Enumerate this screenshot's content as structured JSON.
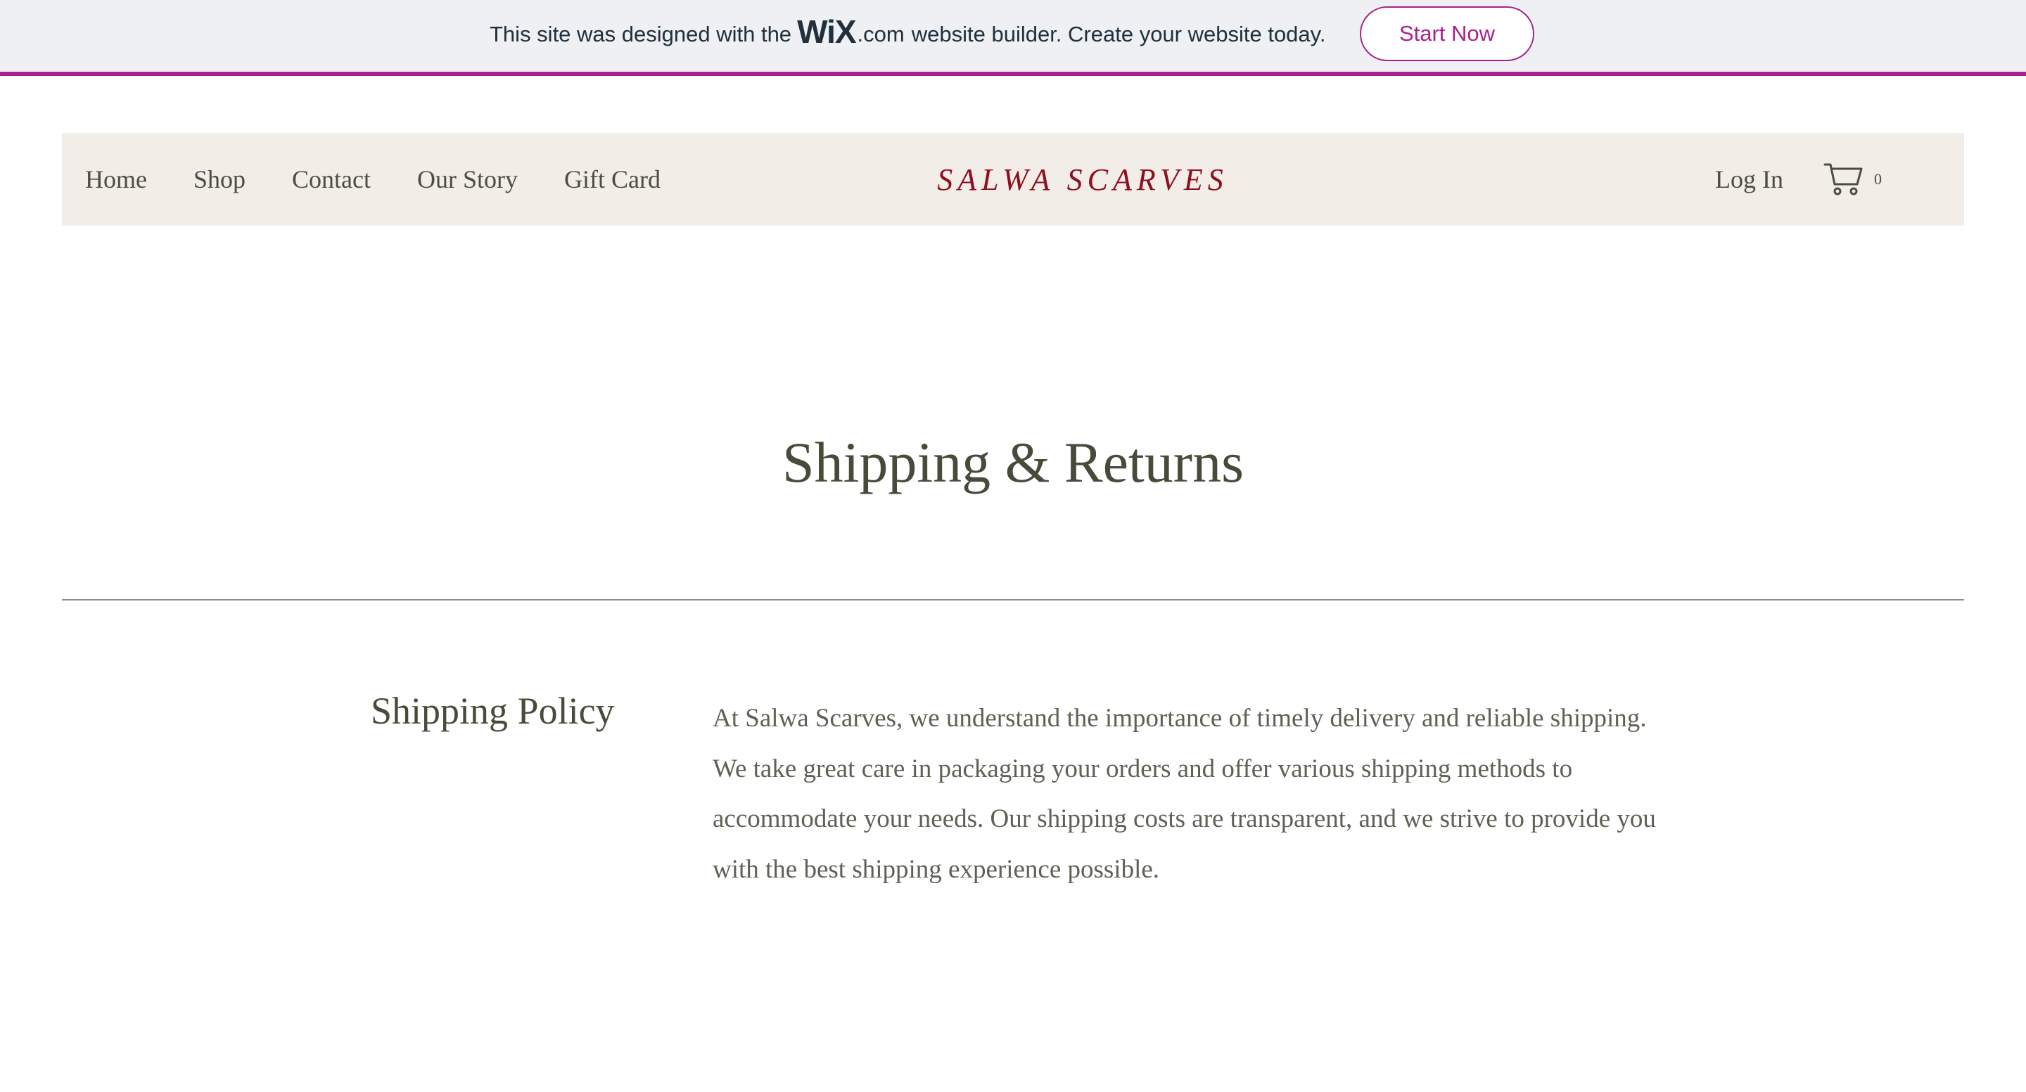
{
  "banner": {
    "text_before": "This site was designed with the",
    "logo": "WiX",
    "logo_suffix": ".com",
    "text_after": "website builder. Create your website today.",
    "cta_label": "Start Now",
    "accent_color": "#a7228c"
  },
  "header": {
    "nav": [
      {
        "label": "Home"
      },
      {
        "label": "Shop"
      },
      {
        "label": "Contact"
      },
      {
        "label": "Our Story"
      },
      {
        "label": "Gift Card"
      }
    ],
    "brand": "SALWA SCARVES",
    "brand_color": "#8c1020",
    "login_label": "Log In",
    "cart_icon": "cart-icon",
    "cart_count": "0",
    "background": "#f2ede7"
  },
  "main": {
    "title": "Shipping & Returns",
    "section": {
      "heading": "Shipping Policy",
      "body": "At Salwa Scarves, we understand the importance of timely delivery and reliable shipping. We take great care in packaging your orders and offer various shipping methods to accommodate your needs. Our shipping costs are transparent, and we strive to provide you with the best shipping experience possible."
    }
  }
}
